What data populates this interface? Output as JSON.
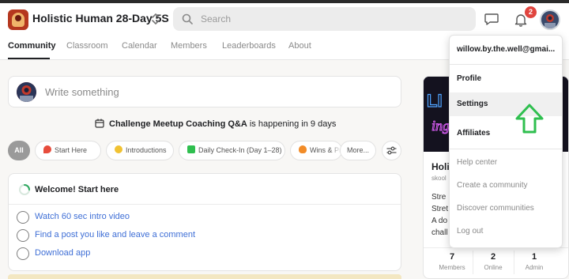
{
  "header": {
    "group_name": "Holistic Human 28-Day 5S",
    "search_placeholder": "Search",
    "notification_count": "2"
  },
  "nav": {
    "tabs": [
      {
        "label": "Community",
        "active": true
      },
      {
        "label": "Classroom"
      },
      {
        "label": "Calendar"
      },
      {
        "label": "Members"
      },
      {
        "label": "Leaderboards"
      },
      {
        "label": "About"
      }
    ]
  },
  "composer": {
    "placeholder": "Write something"
  },
  "event_banner": {
    "title": "Challenge Meetup Coaching Q&A",
    "suffix": "is happening in 9 days"
  },
  "categories": [
    {
      "label": "All",
      "active": true
    },
    {
      "label": "Start Here",
      "icon": "pushpin-icon",
      "color": "#e74c3c"
    },
    {
      "label": "Introductions",
      "icon": "wave-hand-icon",
      "color": "#f1c232"
    },
    {
      "label": "Daily Check-In (Day 1–28)",
      "icon": "checkbox-icon",
      "color": "#2fbf4f"
    },
    {
      "label": "Wins & Pr",
      "icon": "fire-icon",
      "color": "#f28c28"
    },
    {
      "label": "More..."
    }
  ],
  "welcome": {
    "title": "Welcome! Start here",
    "tasks": [
      "Watch 60 sec intro video",
      "Find a post you like and leave a comment",
      "Download app"
    ]
  },
  "group_card": {
    "name": "Holi",
    "url": "skool",
    "desc_lines": [
      "Stre",
      "Stret",
      "A do",
      "chall"
    ],
    "stats": [
      {
        "value": "7",
        "label": "Members"
      },
      {
        "value": "2",
        "label": "Online"
      },
      {
        "value": "1",
        "label": "Admin"
      }
    ]
  },
  "account_menu": {
    "email": "willow.by.the.well@gmai...",
    "primary": [
      "Profile",
      "Settings",
      "Affiliates"
    ],
    "secondary": [
      "Help center",
      "Create a community",
      "Discover communities",
      "Log out"
    ],
    "highlighted": "Settings"
  },
  "colors": {
    "link": "#3f6fd6",
    "badge": "#e0443e",
    "annotation_arrow": "#2fbf4f"
  }
}
